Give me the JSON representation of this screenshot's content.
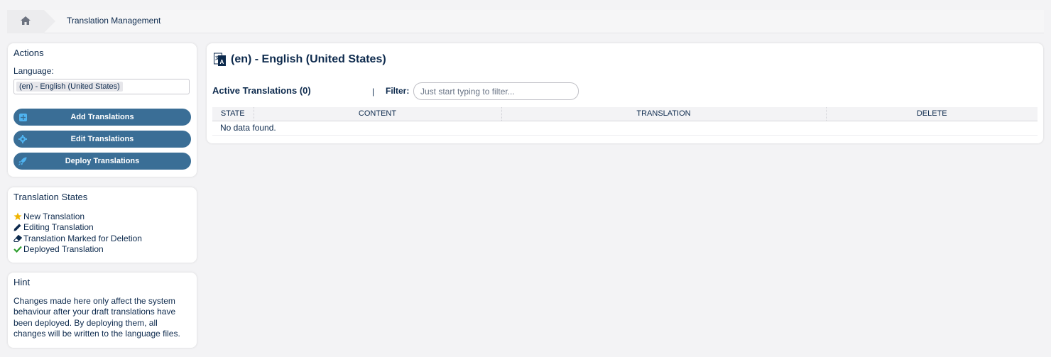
{
  "breadcrumb": {
    "home_icon": "home-icon",
    "current": "Translation Management"
  },
  "sidebar": {
    "actions": {
      "title": "Actions",
      "language_label": "Language:",
      "language_value": "(en) - English (United States)",
      "buttons": [
        {
          "label": "Add Translations",
          "icon": "plus-square-icon"
        },
        {
          "label": "Edit Translations",
          "icon": "gear-icon"
        },
        {
          "label": "Deploy Translations",
          "icon": "rocket-icon"
        }
      ]
    },
    "states": {
      "title": "Translation States",
      "items": [
        {
          "label": "New Translation",
          "icon": "star-icon",
          "color": "#f0b400"
        },
        {
          "label": "Editing Translation",
          "icon": "pencil-icon",
          "color": "#0d2a4d"
        },
        {
          "label": "Translation Marked for Deletion",
          "icon": "eraser-icon",
          "color": "#0d2a4d"
        },
        {
          "label": "Deployed Translation",
          "icon": "check-icon",
          "color": "#2e9e2e"
        }
      ]
    },
    "hint": {
      "title": "Hint",
      "text": "Changes made here only affect the system behaviour after your draft translations have been deployed. By deploying them, all changes will be written to the language files."
    }
  },
  "main": {
    "title": "(en) - English (United States)",
    "flag_icon": "language-flag-icon",
    "active_label": "Active Translations (0)",
    "separator": "|",
    "filter_label": "Filter:",
    "filter_placeholder": "Just start typing to filter...",
    "filter_value": "",
    "columns": [
      "STATE",
      "CONTENT",
      "TRANSLATION",
      "DELETE"
    ],
    "empty_message": "No data found."
  },
  "colors": {
    "button_bg": "#3a6e96",
    "text": "#0d2a4d",
    "button_icon": "#4fb3f0"
  }
}
